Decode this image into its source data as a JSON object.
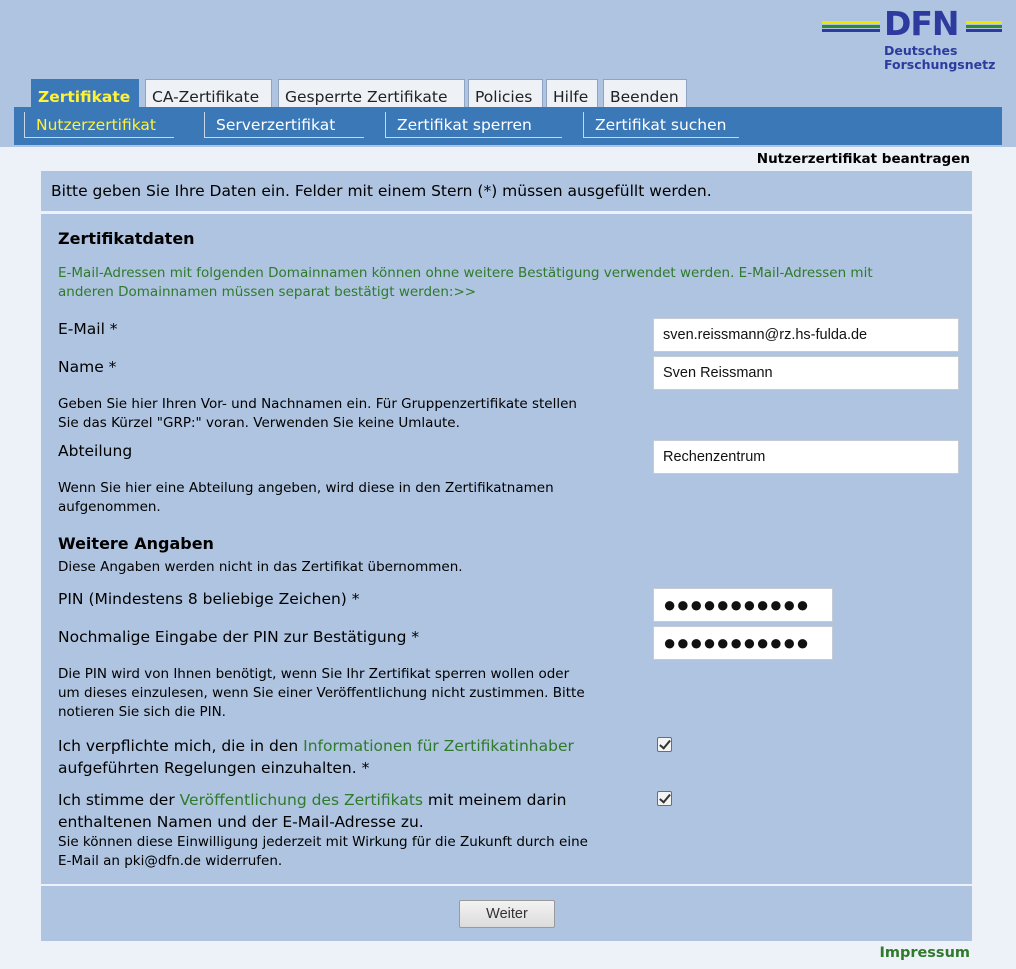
{
  "logo": {
    "wordmark": "DFN",
    "line1": "Deutsches",
    "line2": "Forschungsnetz",
    "colors": {
      "blue": "#2e3b9e",
      "green": "#2f8a2f",
      "yellow": "#f2e600"
    }
  },
  "tabs": [
    {
      "label": "Zertifikate",
      "active": true
    },
    {
      "label": "CA-Zertifikate"
    },
    {
      "label": "Gesperrte Zertifikate"
    },
    {
      "label": "Policies"
    },
    {
      "label": "Hilfe"
    },
    {
      "label": "Beenden"
    }
  ],
  "subnav": [
    {
      "label": "Nutzerzertifikat",
      "active": true
    },
    {
      "label": "Serverzertifikat"
    },
    {
      "label": "Zertifikat sperren"
    },
    {
      "label": "Zertifikat suchen"
    }
  ],
  "page_title": "Nutzerzertifikat beantragen",
  "intro": "Bitte geben Sie Ihre Daten ein. Felder mit einem Stern (*) müssen ausgefüllt werden.",
  "form": {
    "section1_title": "Zertifikatdaten",
    "domain_note_line1": "E-Mail-Adressen mit folgenden Domainnamen können ohne weitere Bestätigung verwendet werden. E-Mail-Adressen mit",
    "domain_note_line2": "anderen Domainnamen müssen separat bestätigt werden:>>",
    "email_label": "E-Mail *",
    "email_value": "sven.reissmann@rz.hs-fulda.de",
    "name_label": "Name *",
    "name_value": "Sven Reissmann",
    "name_help_line1": "Geben Sie hier Ihren Vor- und Nachnamen ein. Für Gruppenzertifikate stellen",
    "name_help_line2": "Sie das Kürzel \"GRP:\" voran. Verwenden Sie keine Umlaute.",
    "dept_label": "Abteilung",
    "dept_value": "Rechenzentrum",
    "dept_help_line1": "Wenn Sie hier eine Abteilung angeben, wird diese in den Zertifikatnamen",
    "dept_help_line2": "aufgenommen.",
    "section2_title": "Weitere Angaben",
    "section2_note": "Diese Angaben werden nicht in das Zertifikat übernommen.",
    "pin_label": "PIN (Mindestens 8 beliebige Zeichen) *",
    "pin_mask": "●●●●●●●●●●●",
    "pin2_label": "Nochmalige Eingabe der PIN zur Bestätigung *",
    "pin2_mask": "●●●●●●●●●●●",
    "pin_help_line1": "Die PIN wird von Ihnen benötigt, wenn Sie Ihr Zertifikat sperren wollen oder",
    "pin_help_line2": "um dieses einzulesen, wenn Sie einer Veröffentlichung nicht zustimmen. Bitte",
    "pin_help_line3": "notieren Sie sich die PIN.",
    "consent1_pre": "Ich verpflichte mich, die in den ",
    "consent1_link": "Informationen für Zertifikatinhaber",
    "consent1_line2": "aufgeführten Regelungen einzuhalten. *",
    "consent1_checked": true,
    "consent2_pre": "Ich stimme der ",
    "consent2_link": "Veröffentlichung des Zertifikats",
    "consent2_post": " mit meinem darin",
    "consent2_line2": "enthaltenen Namen und der E-Mail-Adresse zu.",
    "consent2_checked": true,
    "consent2_help_line1": "Sie können diese Einwilligung jederzeit mit Wirkung für die Zukunft durch eine",
    "consent2_help_line2": "E-Mail an pki@dfn.de widerrufen."
  },
  "submit_label": "Weiter",
  "impressum": "Impressum"
}
